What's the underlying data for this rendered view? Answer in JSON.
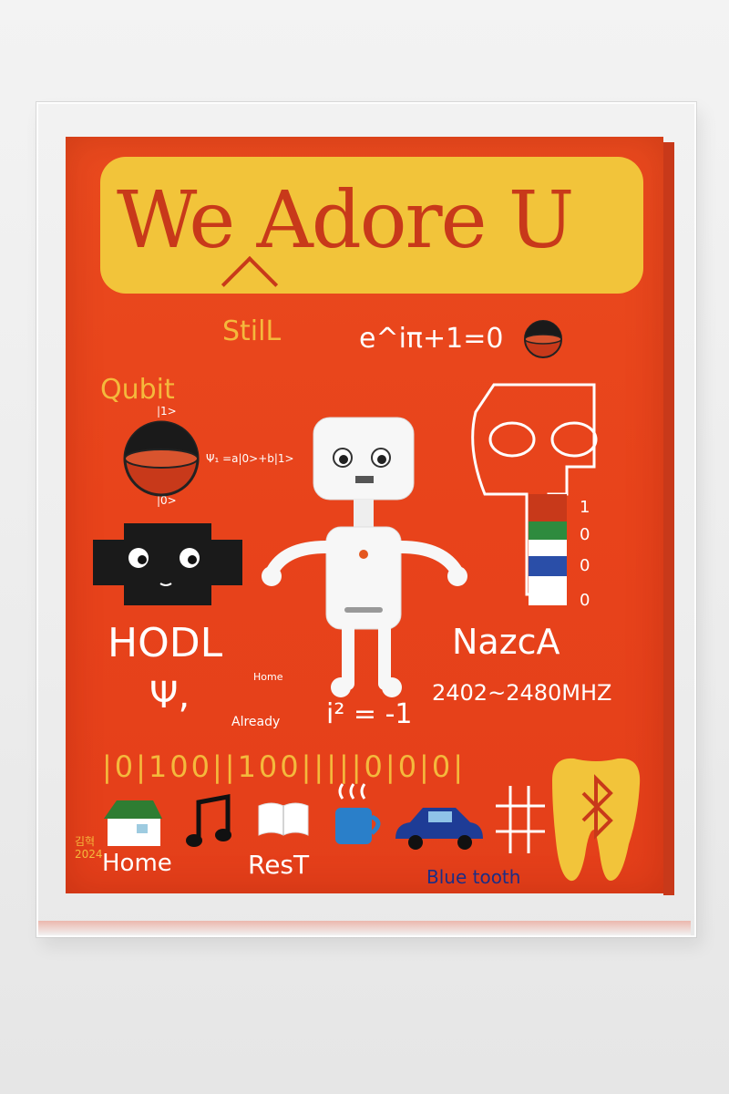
{
  "artwork": {
    "title": "We Adore U",
    "words": {
      "still": "StilL",
      "euler": "e^iπ+1=0",
      "qubit": "Qubit",
      "ket1": "|1>",
      "ket0": "|0>",
      "psi_equation": "Ψ₁ =a|0>+b|1>",
      "hodl": "HODL",
      "psi": "Ψ,",
      "home_small": "Home",
      "already": "Already",
      "i_squared": "i² = -1",
      "nazca": "NazcA",
      "frequency": "2402~2480MHZ",
      "binary": "|0|100||100|||||0|0|0|",
      "home": "Home",
      "rest": "ResT",
      "bluetooth": "Blue tooth",
      "signature_name": "김혁",
      "signature_year": "2024"
    },
    "icons": [
      "qubit-sphere-icon",
      "black-face-icon",
      "skull-figure-icon",
      "small-sphere-icon",
      "house-icon",
      "music-note-icon",
      "open-book-icon",
      "coffee-cup-icon",
      "car-icon",
      "hashtag-icon",
      "bluetooth-tooth-icon",
      "airpods-robot-icon"
    ],
    "colors": {
      "canvas": "#e8431b",
      "banner": "#f2c43a",
      "text": "#ffffff",
      "accent_yellow": "#f4b93c"
    }
  }
}
